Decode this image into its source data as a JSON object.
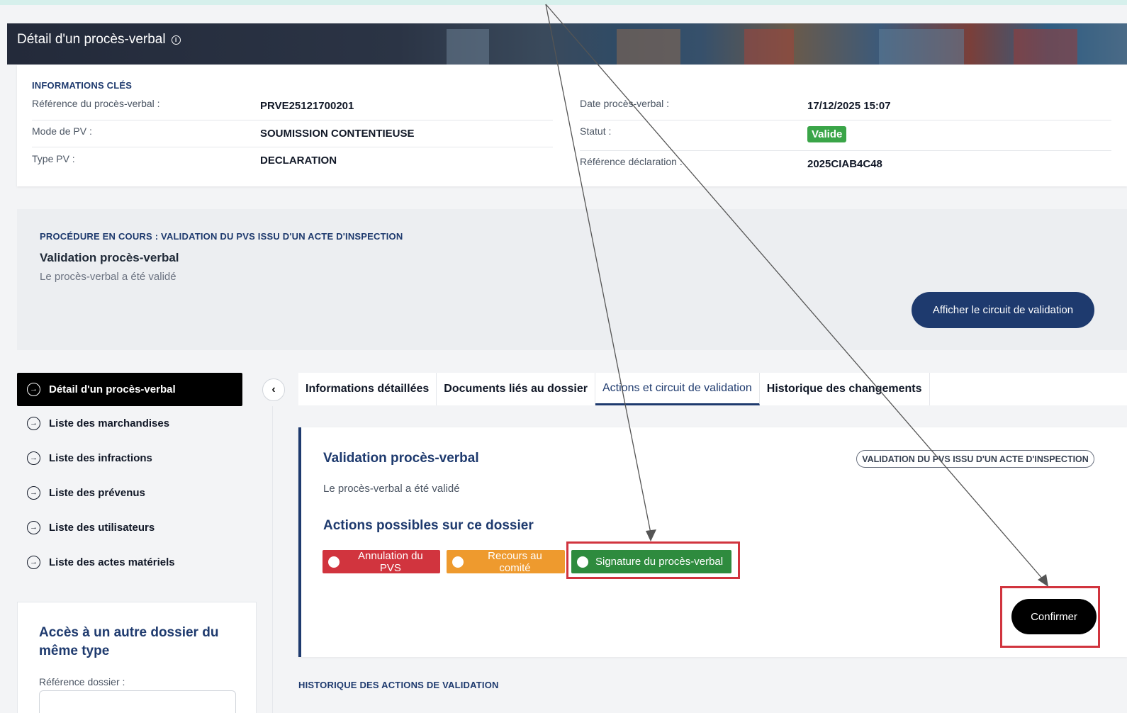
{
  "banner": {
    "title": "Détail d'un procès-verbal"
  },
  "key_info": {
    "section_label": "INFORMATIONS CLÉS",
    "left": [
      {
        "label": "Référence du procès-verbal :",
        "value": "PRVE25121700201"
      },
      {
        "label": "Mode de PV :",
        "value": "SOUMISSION CONTENTIEUSE"
      },
      {
        "label": "Type PV :",
        "value": "DECLARATION"
      }
    ],
    "right": [
      {
        "label": "Date procès-verbal :",
        "value": "17/12/2025 15:07"
      },
      {
        "label": "Statut :",
        "value": "Valide"
      },
      {
        "label": "Référence déclaration :",
        "value": "2025CIAB4C48"
      }
    ]
  },
  "procedure": {
    "label": "PROCÉDURE EN COURS : VALIDATION DU PVS ISSU D'UN ACTE D'INSPECTION",
    "title": "Validation procès-verbal",
    "description": "Le procès-verbal a été validé",
    "button": "Afficher le circuit de validation"
  },
  "sidebar": {
    "items": [
      {
        "label": "Détail d'un procès-verbal",
        "active": true
      },
      {
        "label": "Liste des marchandises"
      },
      {
        "label": "Liste des infractions"
      },
      {
        "label": "Liste des prévenus"
      },
      {
        "label": "Liste des utilisateurs"
      },
      {
        "label": "Liste des actes matériels"
      }
    ],
    "access_card": {
      "title": "Accès à un autre dossier du même type",
      "field_label": "Référence dossier :"
    }
  },
  "tabs": [
    {
      "label": "Informations détaillées"
    },
    {
      "label": "Documents liés au dossier"
    },
    {
      "label": "Actions et circuit de validation",
      "active": true
    },
    {
      "label": "Historique des changements"
    }
  ],
  "validation": {
    "title": "Validation procès-verbal",
    "badge": "VALIDATION DU PVS ISSU D'UN ACTE D'INSPECTION",
    "description": "Le procès-verbal a été validé",
    "actions_title": "Actions possibles sur ce dossier",
    "actions": [
      {
        "label": "Annulation du PVS",
        "color": "#d1343e"
      },
      {
        "label": "Recours au comité",
        "color": "#ee9a2e"
      },
      {
        "label": "Signature du procès-verbal",
        "color": "#2e8b3e"
      }
    ],
    "confirm": "Confirmer"
  },
  "history": {
    "label": "HISTORIQUE DES ACTIONS DE VALIDATION"
  },
  "colors": {
    "navy": "#1e3a6e",
    "annotation_red": "#d1343e",
    "status_green": "#3aa548"
  }
}
